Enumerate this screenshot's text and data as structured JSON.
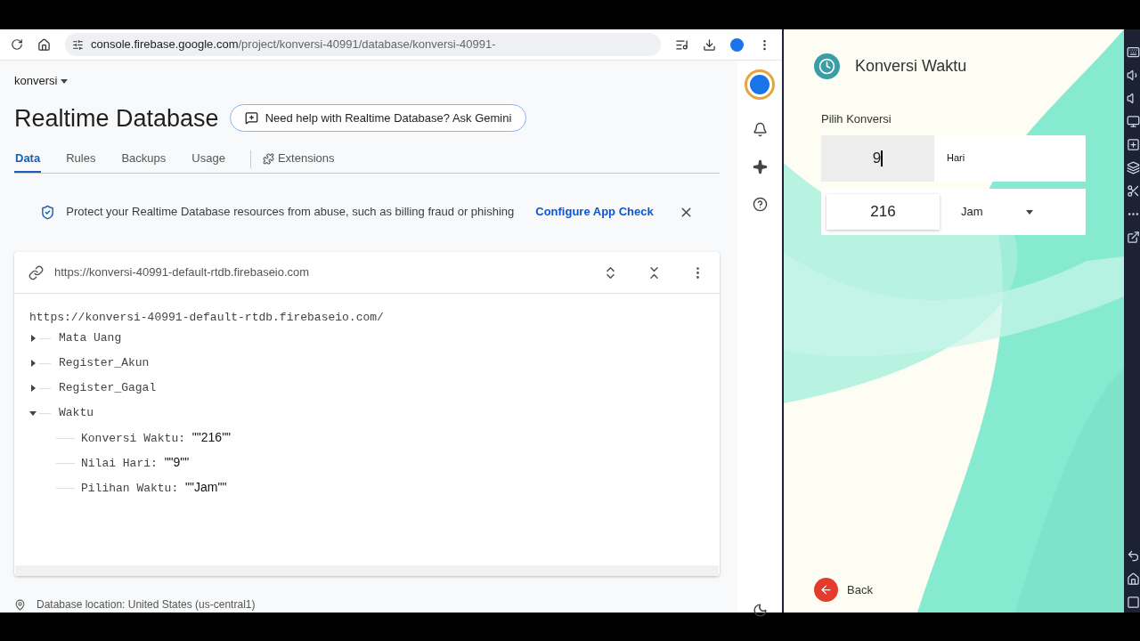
{
  "browser": {
    "host": "console.firebase.google.com",
    "path": "/project/konversi-40991/database/konversi-40991-"
  },
  "console": {
    "project": "konversi",
    "title": "Realtime Database",
    "gemini_button": "Need help with Realtime Database? Ask Gemini",
    "tabs": [
      {
        "label": "Data",
        "selected": true,
        "kind": "plain"
      },
      {
        "label": "Rules",
        "selected": false,
        "kind": "plain"
      },
      {
        "label": "Backups",
        "selected": false,
        "kind": "plain"
      },
      {
        "label": "Usage",
        "selected": false,
        "kind": "plain"
      },
      {
        "label": "Extensions",
        "selected": false,
        "kind": "extension"
      }
    ],
    "banner": {
      "text": "Protect your Realtime Database resources from abuse, such as billing fraud or phishing",
      "link": "Configure App Check"
    },
    "database": {
      "url": "https://konversi-40991-default-rtdb.firebaseio.com",
      "root": "https://konversi-40991-default-rtdb.firebaseio.com/",
      "tree": [
        {
          "key": "Mata Uang",
          "expanded": false
        },
        {
          "key": "Register_Akun",
          "expanded": false
        },
        {
          "key": "Register_Gagal",
          "expanded": false
        },
        {
          "key": "Waktu",
          "expanded": true,
          "children": [
            {
              "key": "Konversi Waktu:",
              "value": "\"\"216\"\""
            },
            {
              "key": "Nilai Hari:",
              "value": "\"\"9\"\""
            },
            {
              "key": "Pilihan Waktu:",
              "value": "\"\"Jam\"\""
            }
          ]
        }
      ]
    },
    "footer": "Database location: United States (us-central1)"
  },
  "app": {
    "title": "Konversi Waktu",
    "label": "Pilih Konversi",
    "rows": [
      {
        "kind": "input",
        "value": "9",
        "unit": "Hari",
        "focused": true
      },
      {
        "kind": "select",
        "value": "216",
        "unit": "Jam",
        "focused": false
      }
    ],
    "back": "Back"
  }
}
